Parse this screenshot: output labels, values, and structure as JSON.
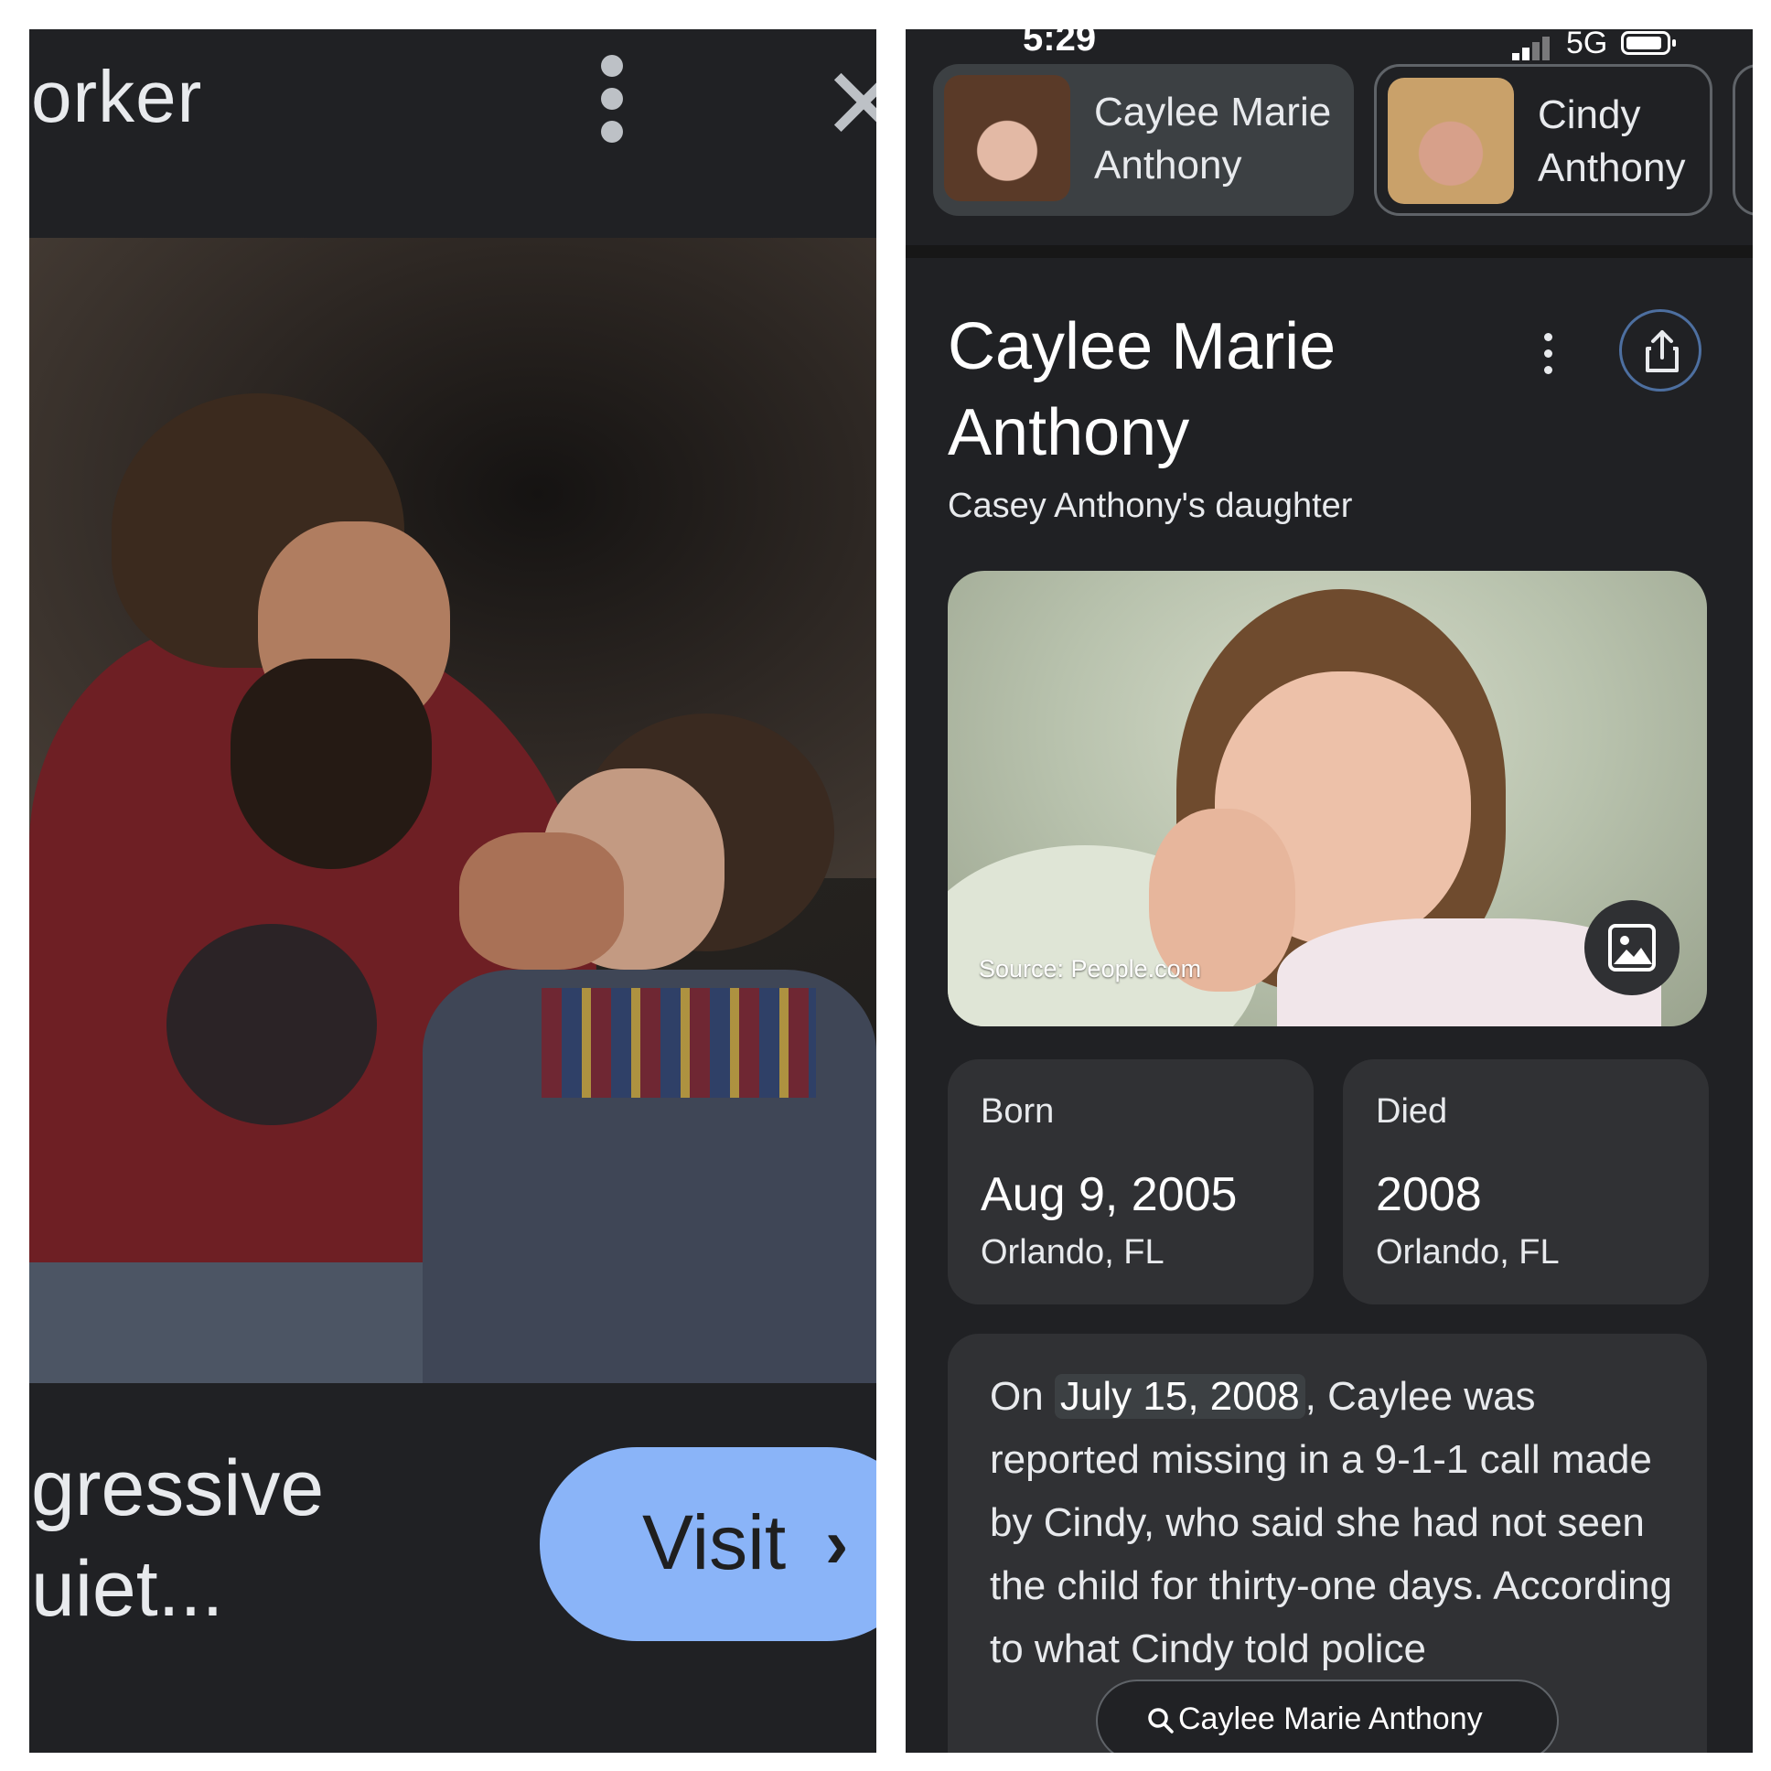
{
  "left_panel": {
    "site_name_fragment": "orker",
    "article_title_fragment": "gressive\nuiet...",
    "visit_button": {
      "label": "Visit",
      "chevron": "›"
    },
    "icons": [
      "more-vert-icon",
      "close-icon",
      "chevron-right-icon"
    ]
  },
  "right_panel": {
    "status_bar": {
      "time": "5:29",
      "network": "5G"
    },
    "chips": [
      {
        "label": "Caylee Marie Anthony",
        "selected": true
      },
      {
        "label": "Cindy Anthony",
        "selected": false
      }
    ],
    "knowledge_panel": {
      "title": "Caylee Marie Anthony",
      "subtitle": "Casey Anthony's daughter",
      "image_source": "Source: People.com",
      "facts": [
        {
          "key": "Born",
          "value": "Aug 9, 2005",
          "place": "Orlando, FL"
        },
        {
          "key": "Died",
          "value": "2008",
          "place": "Orlando, FL"
        }
      ],
      "description": {
        "pre": "On ",
        "highlight": "July 15, 2008",
        "post": ", Caylee was reported missing in a 9-1-1 call made by Cindy, who said she had not seen the child for thirty-one days. According to what Cindy told police"
      }
    },
    "floating_search": {
      "label": "Caylee Marie Anthony"
    },
    "colors": {
      "background": "#202124",
      "card": "#303134",
      "accent": "#8ab4f8"
    }
  }
}
